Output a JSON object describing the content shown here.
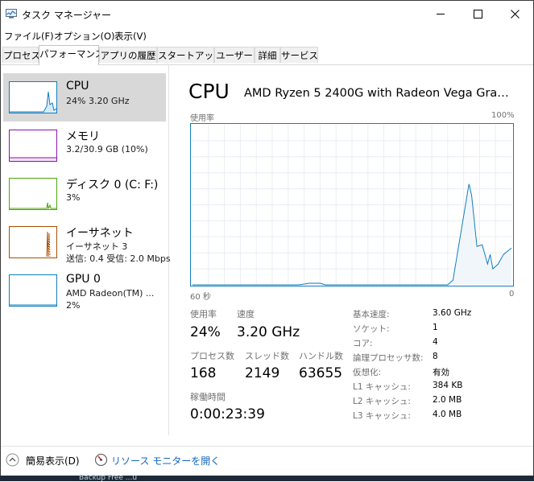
{
  "window": {
    "title": "タスク マネージャー",
    "icon": "task-manager-icon"
  },
  "menu": [
    "ファイル(F)",
    "オプション(O)",
    "表示(V)"
  ],
  "tabs": [
    "プロセス",
    "パフォーマンス",
    "アプリの履歴",
    "スタートアップ",
    "ユーザー",
    "詳細",
    "サービス"
  ],
  "sidebar": [
    {
      "name": "CPU",
      "sub1": "24%  3.20 GHz",
      "sub2": "",
      "color": "#117dbb"
    },
    {
      "name": "メモリ",
      "sub1": "3.2/30.9 GB (10%)",
      "sub2": "",
      "color": "#8b12ae"
    },
    {
      "name": "ディスク 0 (C: F:)",
      "sub1": "3%",
      "sub2": "",
      "color": "#4da60c"
    },
    {
      "name": "イーサネット",
      "sub1": "イーサネット 3",
      "sub2": "送信: 0.4  受信: 2.0 Mbps",
      "color": "#a74f01"
    },
    {
      "name": "GPU 0",
      "sub1": "AMD Radeon(TM) ...",
      "sub2": "2%",
      "color": "#117dbb"
    }
  ],
  "main": {
    "title": "CPU",
    "model": "AMD Ryzen 5 2400G with Radeon Vega Graphics",
    "graph_label": "使用率",
    "graph_max": "100%",
    "time_span": "60 秒",
    "time_zero": "0"
  },
  "stats": {
    "usage_label": "使用率",
    "usage": "24%",
    "speed_label": "速度",
    "speed": "3.20 GHz",
    "processes_label": "プロセス数",
    "processes": "168",
    "threads_label": "スレッド数",
    "threads": "2149",
    "handles_label": "ハンドル数",
    "handles": "63655",
    "uptime_label": "稼働時間",
    "uptime": "0:00:23:39"
  },
  "info": [
    {
      "label": "基本速度:",
      "value": "3.60 GHz"
    },
    {
      "label": "ソケット:",
      "value": "1"
    },
    {
      "label": "コア:",
      "value": "4"
    },
    {
      "label": "論理プロセッサ数:",
      "value": "8"
    },
    {
      "label": "仮想化:",
      "value": "有効"
    },
    {
      "label": "L1 キャッシュ:",
      "value": "384 KB"
    },
    {
      "label": "L2 キャッシュ:",
      "value": "2.0 MB"
    },
    {
      "label": "L3 キャッシュ:",
      "value": "4.0 MB"
    }
  ],
  "bottom": {
    "fewer_details": "簡易表示(D)",
    "resource_monitor": "リソース モニターを開く"
  },
  "taskbar": {
    "text": "Backup Free ...u"
  },
  "chart_data": {
    "type": "area",
    "ylim": [
      0,
      100
    ],
    "xlim": [
      60,
      0
    ],
    "xlabel": "60 秒",
    "ylabel": "使用率",
    "grid": true,
    "color": "#117dbb",
    "x": [
      60,
      45,
      40,
      38,
      36,
      35,
      12,
      11,
      10.5,
      8,
      7.5,
      6.5,
      5.5,
      4.5,
      4,
      3.5,
      2.5,
      1.5,
      0
    ],
    "y": [
      0,
      0,
      0,
      1,
      1,
      0,
      0,
      3,
      13,
      63,
      56,
      24,
      25,
      13,
      19,
      10,
      13,
      19,
      23
    ]
  }
}
